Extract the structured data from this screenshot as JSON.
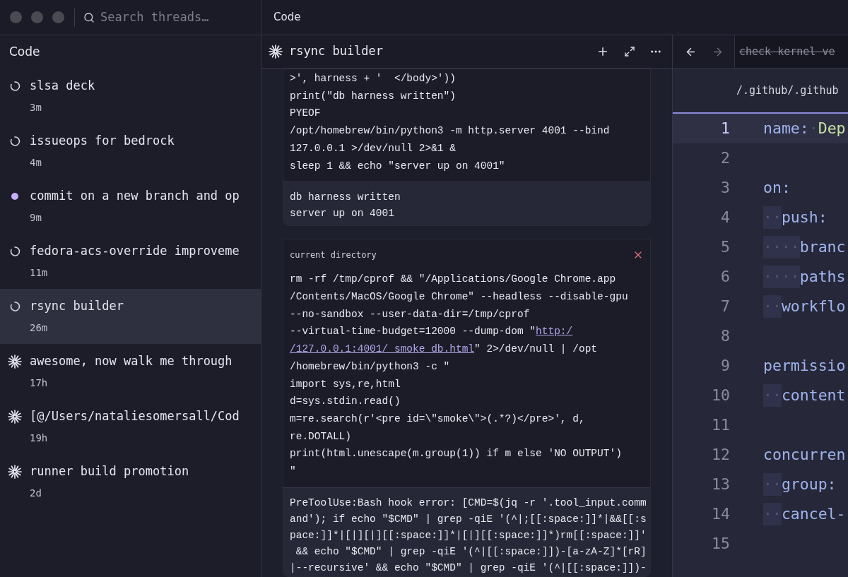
{
  "topbar": {
    "search": {
      "placeholder": "Search threads…"
    },
    "title": "Code"
  },
  "sidebar": {
    "title": "Code",
    "threads": [
      {
        "title": "slsa deck",
        "age": "3m",
        "kind": "spinner",
        "selected": false
      },
      {
        "title": "issueops for bedrock",
        "age": "4m",
        "kind": "spinner",
        "selected": false
      },
      {
        "title": "commit on a new branch and op",
        "age": "9m",
        "kind": "dot",
        "selected": false
      },
      {
        "title": "fedora-acs-override improveme",
        "age": "11m",
        "kind": "spinner",
        "selected": false
      },
      {
        "title": "rsync builder",
        "age": "26m",
        "kind": "spinner",
        "selected": true
      },
      {
        "title": "awesome, now walk me through",
        "age": "17h",
        "kind": "burst",
        "selected": false
      },
      {
        "title": "[@/Users/nataliesomersall/Cod",
        "age": "19h",
        "kind": "burst",
        "selected": false
      },
      {
        "title": "runner build promotion",
        "age": "2d",
        "kind": "burst",
        "selected": false
      }
    ]
  },
  "thread": {
    "title": "rsync builder",
    "cards": [
      {
        "lines": [
          ">', harness + '  </body>'))",
          "print(\"db harness written\")",
          "PYEOF",
          "/opt/homebrew/bin/python3 -m http.server 4001 --bind",
          "127.0.0.1 >/dev/null 2>&1 &",
          "sleep 1 && echo \"server up on 4001\""
        ],
        "result": [
          "db harness written",
          "server up on 4001"
        ]
      },
      {
        "label": "current directory",
        "closable": true,
        "lines": [
          "rm -rf /tmp/cprof && \"/Applications/Google Chrome.app",
          "/Contents/MacOS/Google Chrome\" --headless --disable-gpu",
          "--no-sandbox --user-data-dir=/tmp/cprof",
          {
            "parts": [
              {
                "text": "--virtual-time-budget=12000 --dump-dom \"",
                "kind": "plain"
              },
              {
                "text": "http:/",
                "kind": "link"
              }
            ]
          },
          {
            "parts": [
              {
                "text": "/127.0.0.1:4001/_smoke_db.html",
                "kind": "link"
              },
              {
                "text": "\" 2>/dev/null | /opt",
                "kind": "plain"
              }
            ]
          },
          "/homebrew/bin/python3 -c \"",
          "import sys,re,html",
          "d=sys.stdin.read()",
          "m=re.search(r'<pre id=\\\"smoke\\\">(.*?)</pre>', d,",
          "re.DOTALL)",
          "print(html.unescape(m.group(1)) if m else 'NO OUTPUT')",
          "\""
        ],
        "result": [
          "PreToolUse:Bash hook error: [CMD=$(jq -r '.tool_input.comm",
          "and'); if echo \"$CMD\" | grep -qiE '(^|;[[:space:]]*|&&[[:s",
          "pace:]]*|[|][|][[:space:]]*|[|][[:space:]]*)rm[[:space:]]'",
          " && echo \"$CMD\" | grep -qiE '(^|[[:space:]])-[a-zA-Z]*[rR]",
          "|--recursive' && echo \"$CMD\" | grep -qiE '(^|[[:space:]])-"
        ]
      }
    ]
  },
  "editor": {
    "back": {
      "disabled": false
    },
    "forward": {
      "disabled": true
    },
    "tab": {
      "title": "check kernel ve",
      "strikethrough": true
    },
    "path": "/.github/.github",
    "lines": [
      {
        "number": "1",
        "active": true,
        "tokens": [
          {
            "text": "name:",
            "kind": "key"
          },
          {
            "text": "·",
            "kind": "ws"
          },
          {
            "text": "Dep",
            "kind": "string"
          }
        ]
      },
      {
        "number": "2",
        "active": false
      },
      {
        "number": "3",
        "active": false,
        "tokens": [
          {
            "text": "on:",
            "kind": "key"
          }
        ]
      },
      {
        "number": "4",
        "active": false,
        "indent": "··",
        "tokens": [
          {
            "text": "push:",
            "kind": "key"
          }
        ]
      },
      {
        "number": "5",
        "active": false,
        "indent": "····",
        "tokens": [
          {
            "text": "branc",
            "kind": "key"
          }
        ]
      },
      {
        "number": "6",
        "active": false,
        "indent": "····",
        "tokens": [
          {
            "text": "paths",
            "kind": "key"
          }
        ]
      },
      {
        "number": "7",
        "active": false,
        "indent": "··",
        "tokens": [
          {
            "text": "workflo",
            "kind": "key"
          }
        ]
      },
      {
        "number": "8",
        "active": false
      },
      {
        "number": "9",
        "active": false,
        "tokens": [
          {
            "text": "permissio",
            "kind": "key"
          }
        ]
      },
      {
        "number": "10",
        "active": false,
        "indent": "··",
        "tokens": [
          {
            "text": "content",
            "kind": "key"
          }
        ]
      },
      {
        "number": "11",
        "active": false
      },
      {
        "number": "12",
        "active": false,
        "tokens": [
          {
            "text": "concurren",
            "kind": "key"
          }
        ]
      },
      {
        "number": "13",
        "active": false,
        "indent": "··",
        "tokens": [
          {
            "text": "group:",
            "kind": "key"
          }
        ]
      },
      {
        "number": "14",
        "active": false,
        "indent": "··",
        "tokens": [
          {
            "text": "cancel-",
            "kind": "key"
          }
        ]
      },
      {
        "number": "15",
        "active": false
      }
    ]
  }
}
